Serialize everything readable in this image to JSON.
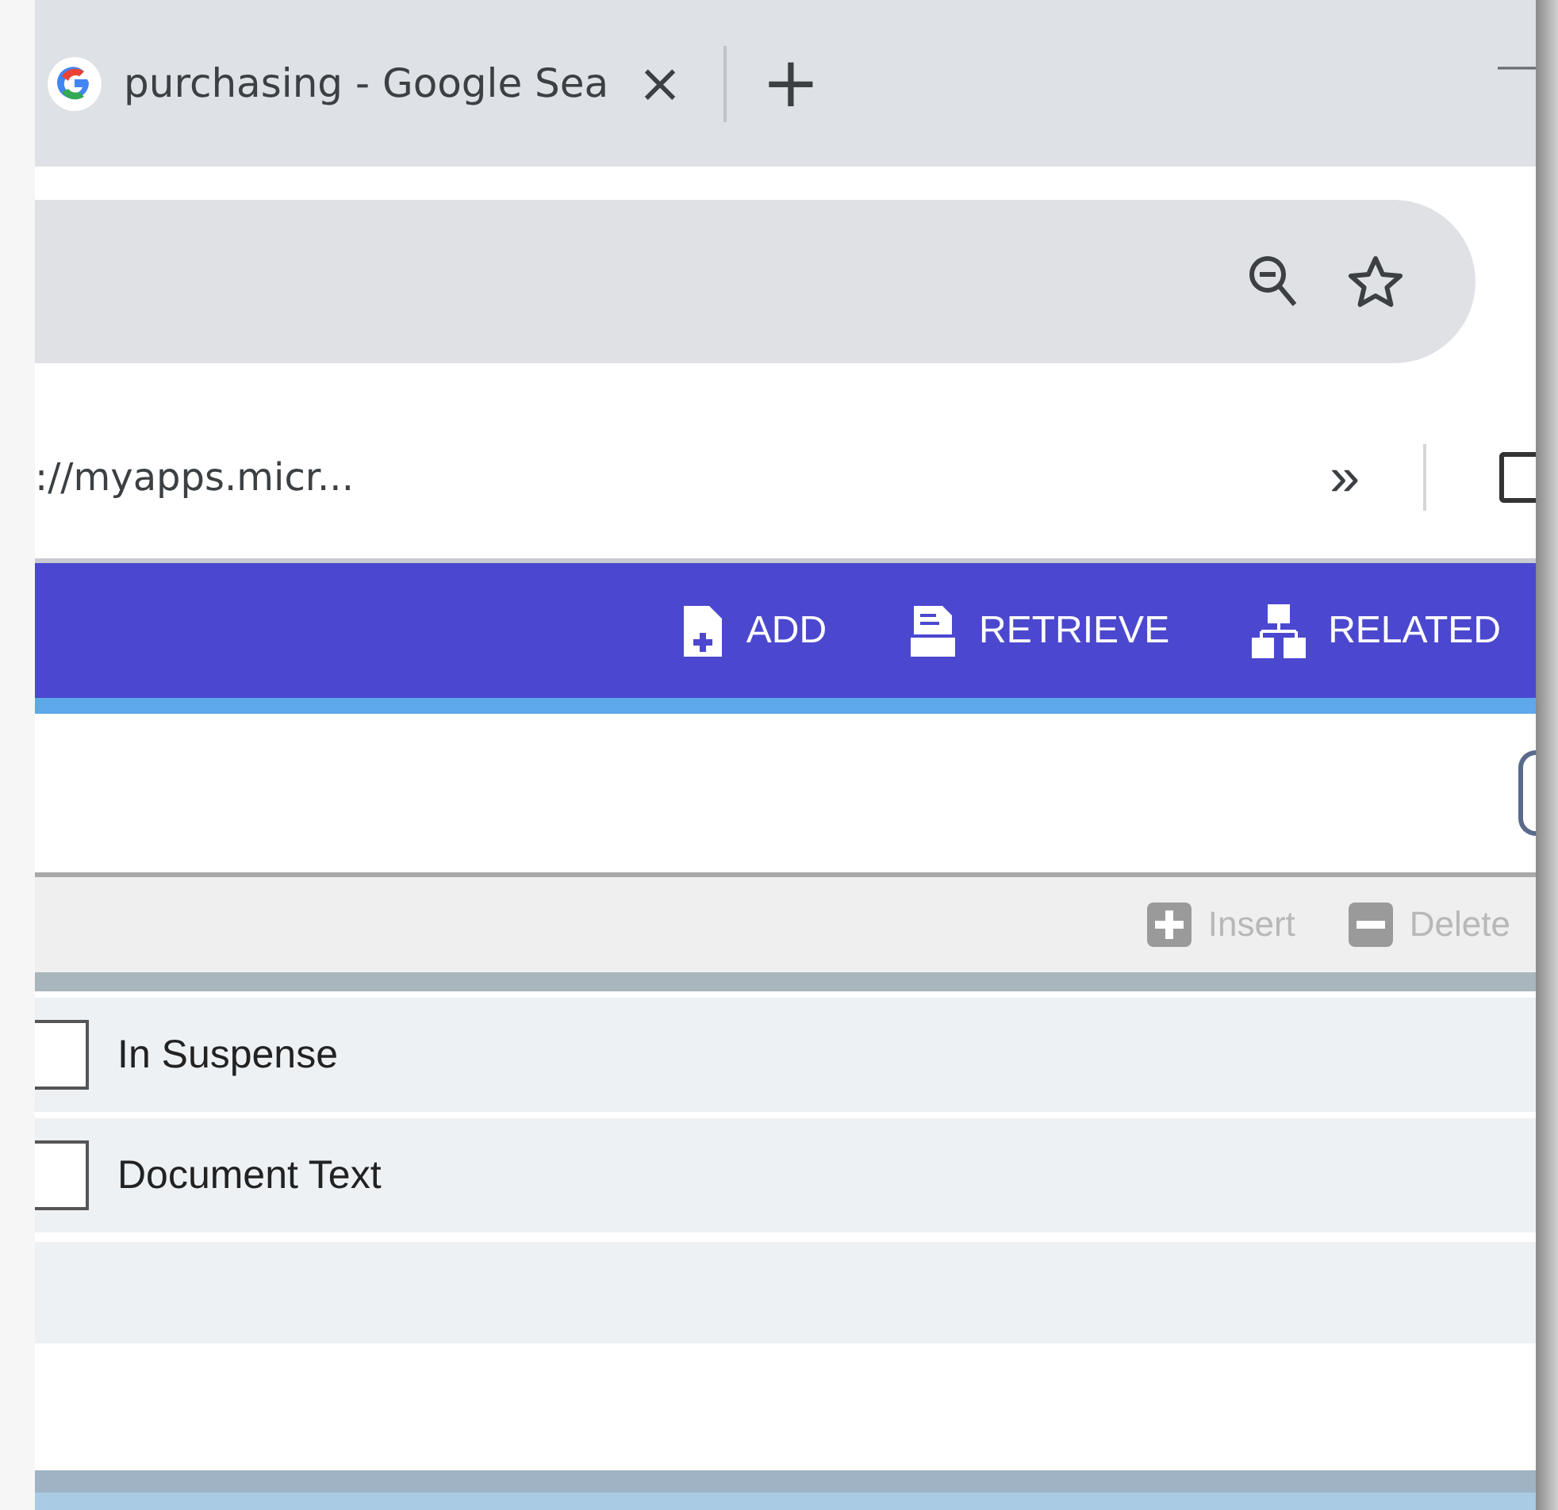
{
  "browser": {
    "tab": {
      "title": "purchasing - Google Sea",
      "close": "×"
    },
    "new_tab": "+",
    "minimize": "—",
    "bookmarks": {
      "url": "://myapps.micr...",
      "more": "»"
    }
  },
  "app_toolbar": {
    "buttons": [
      {
        "label": "ADD",
        "kind": "add"
      },
      {
        "label": "RETRIEVE",
        "kind": "retrieve"
      },
      {
        "label": "RELATED",
        "kind": "related"
      }
    ]
  },
  "grid_toolbar": {
    "buttons": [
      {
        "label": "Insert",
        "kind": "insert",
        "disabled": true
      },
      {
        "label": "Delete",
        "kind": "delete",
        "disabled": true
      }
    ]
  },
  "rows": [
    {
      "label": "In Suspense",
      "checked": false
    },
    {
      "label": "Document Text",
      "checked": false
    }
  ]
}
